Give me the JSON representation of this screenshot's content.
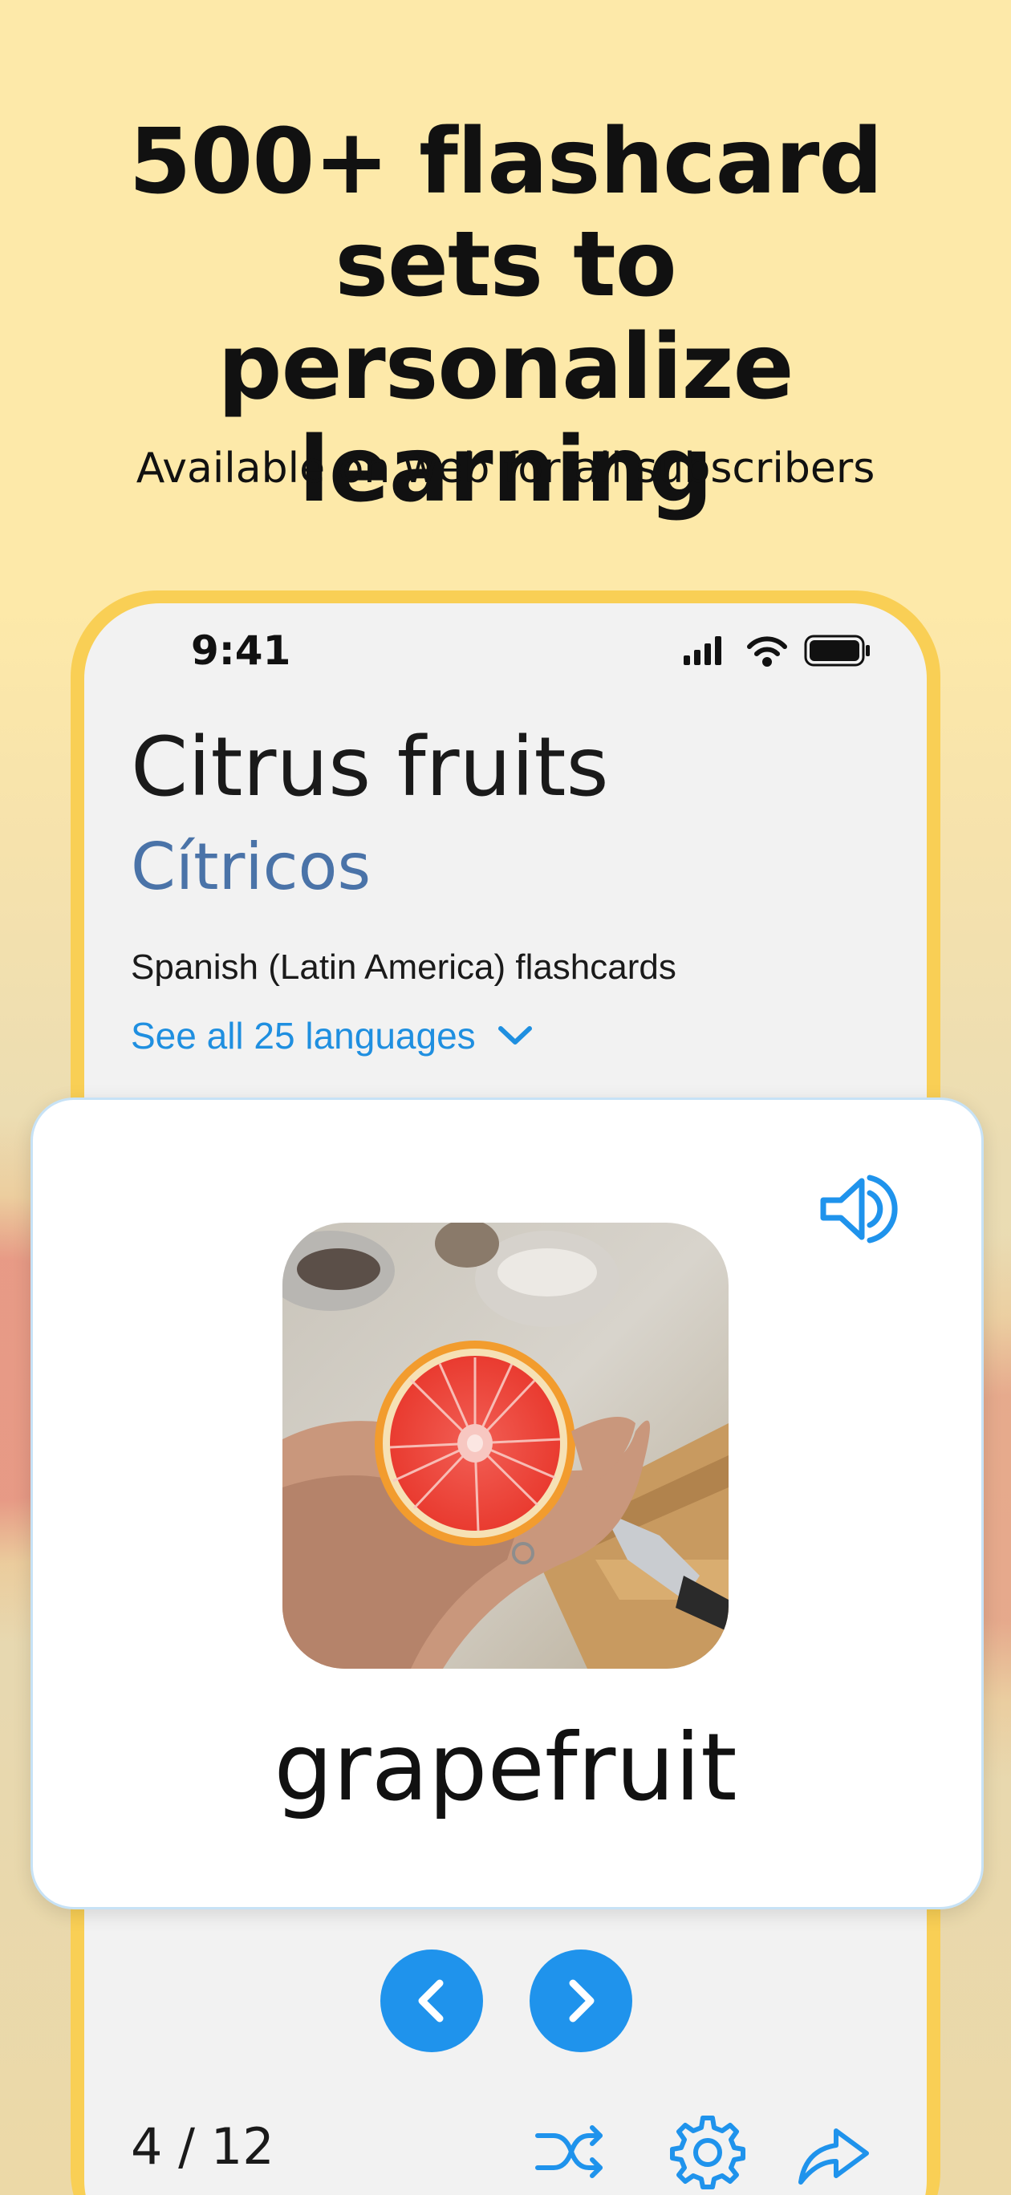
{
  "promo": {
    "headline_line1": "500+ flashcard",
    "headline_line2": "sets to personalize",
    "headline_line3": "learning",
    "subheadline": "Available on web for all subscribers"
  },
  "status_bar": {
    "time": "9:41",
    "icons": [
      "signal-icon",
      "wifi-icon",
      "battery-icon"
    ]
  },
  "flashcard_set": {
    "title": "Citrus fruits",
    "translation": "Cítricos",
    "subtitle": "Spanish (Latin America) flashcards",
    "languages_link": "See all 25 languages"
  },
  "card": {
    "word": "grapefruit",
    "image": "grapefruit-half-in-hand-photo",
    "audio_icon": "speaker-icon"
  },
  "navigation": {
    "prev_icon": "chevron-left-icon",
    "next_icon": "chevron-right-icon"
  },
  "progress": {
    "counter": "4 / 12",
    "current": 4,
    "total": 12
  },
  "toolbar": {
    "icons": [
      "shuffle-icon",
      "gear-icon",
      "share-icon"
    ]
  },
  "colors": {
    "background": "#fde9a9",
    "phone_frame": "#f9cf55",
    "accent": "#1f93ec",
    "translation": "#4a73a8",
    "card_border": "#c7e2f6"
  }
}
